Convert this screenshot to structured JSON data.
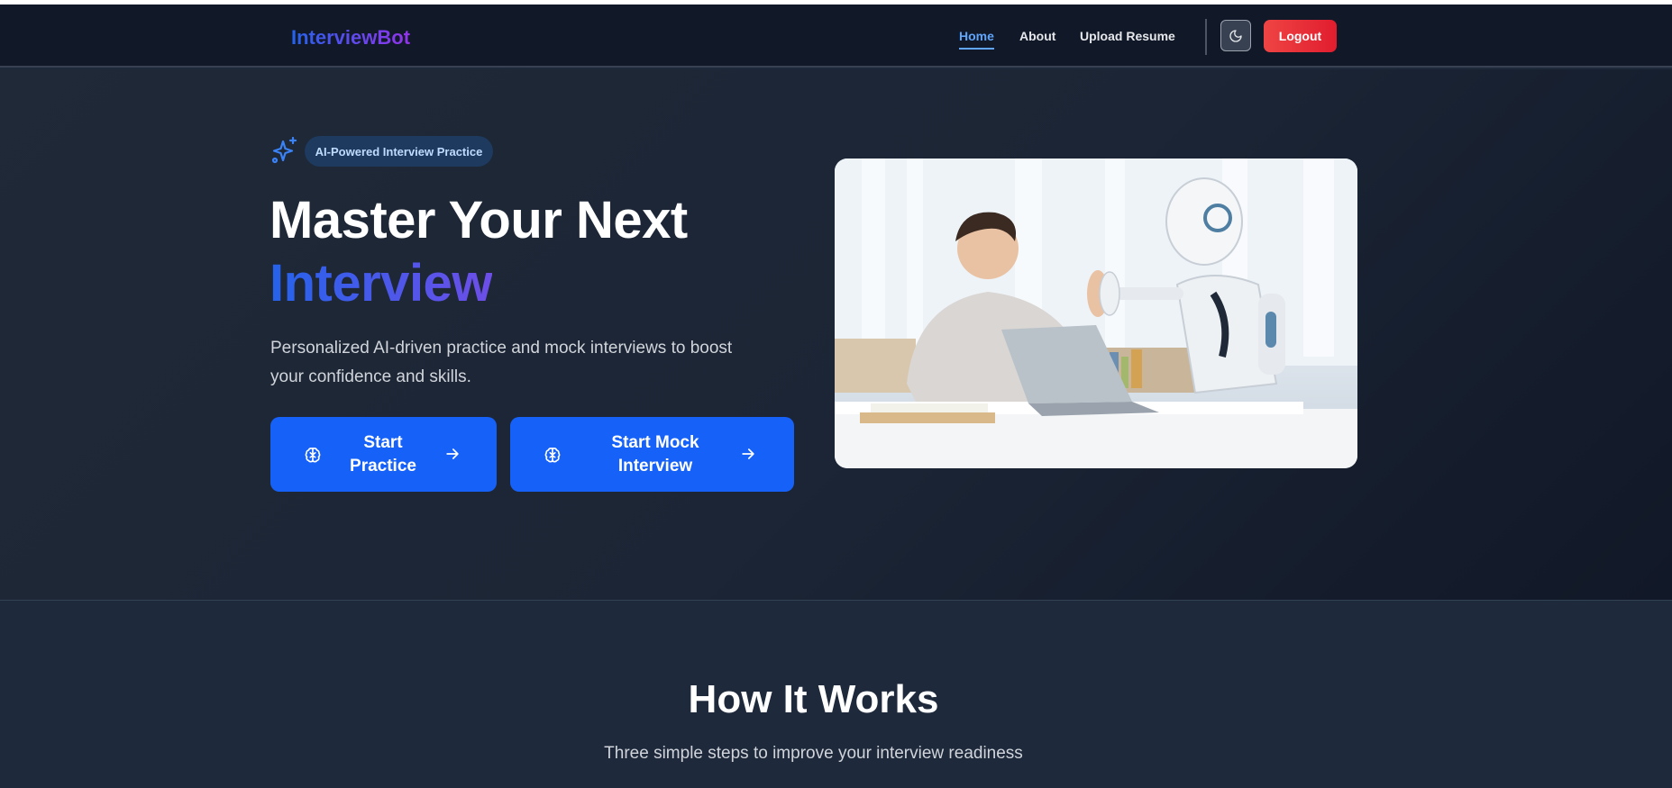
{
  "nav": {
    "brand": "InterviewBot",
    "links": [
      {
        "label": "Home",
        "active": true
      },
      {
        "label": "About",
        "active": false
      },
      {
        "label": "Upload Resume",
        "active": false
      }
    ],
    "theme_toggle_icon": "moon-icon",
    "logout_label": "Logout"
  },
  "hero": {
    "badge_icon": "sparkles-icon",
    "badge_label": "AI-Powered Interview Practice",
    "title_line1": "Master Your Next",
    "title_line2": "Interview",
    "subtitle": "Personalized AI-driven practice and mock interviews to boost your confidence and skills.",
    "buttons": [
      {
        "label": "Start Practice",
        "icon": "brain-icon",
        "trailing_icon": "arrow-right-icon"
      },
      {
        "label": "Start Mock Interview",
        "icon": "brain-icon",
        "trailing_icon": "arrow-right-icon"
      }
    ],
    "image": "student-high-fiving-robot-at-desk"
  },
  "how_it_works": {
    "title": "How It Works",
    "subtitle": "Three simple steps to improve your interview readiness"
  },
  "colors": {
    "nav_bg": "#111827",
    "hero_bg": "#1f2937",
    "primary_button": "#1662f9",
    "logout_button": "#ef4444",
    "active_link": "#60a5fa",
    "brand_gradient_start": "#2563eb",
    "brand_gradient_end": "#9333ea"
  }
}
